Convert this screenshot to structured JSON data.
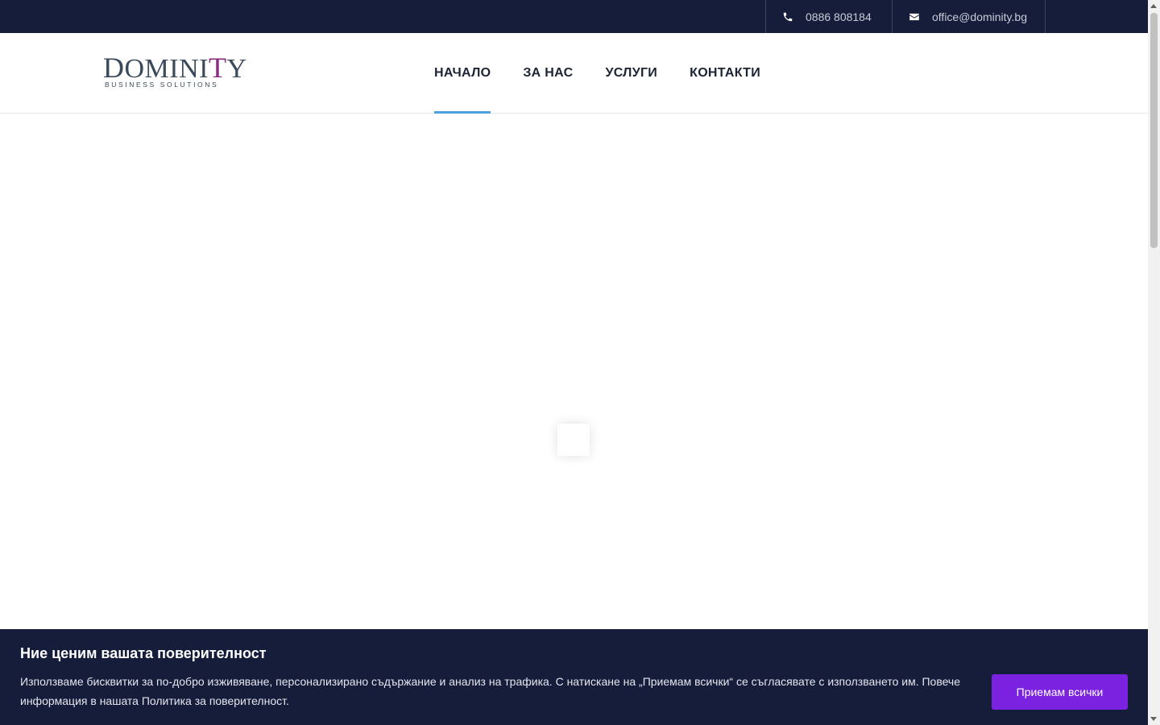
{
  "topbar": {
    "phone": {
      "icon": "phone-icon",
      "text": "0886 808184"
    },
    "email": {
      "icon": "envelope-icon",
      "text": "office@dominity.bg"
    }
  },
  "logo": {
    "word": "DominiTy",
    "tagline": "BUSINESS SOLUTIONS"
  },
  "nav": {
    "items": [
      {
        "label": "НАЧАЛО",
        "active": true
      },
      {
        "label": "ЗА НАС",
        "active": false
      },
      {
        "label": "УСЛУГИ",
        "active": false
      },
      {
        "label": "КОНТАКТИ",
        "active": false
      }
    ]
  },
  "cookie": {
    "title": "Ние ценим вашата поверителност",
    "text": "Използваме бисквитки за по-добро изживяване, персонализирано съдържание и анализ на трафика. С натискане на „Приемам всички“ се съгласявате с използването им. Повече информация в нашата Политика за поверителност.",
    "accept_label": "Приемам всички"
  },
  "colors": {
    "topbar_bg": "#151d3b",
    "nav_active_underline": "#4aa3df",
    "logo_accent": "#8a2a7f",
    "accept_button": "#7b22e0"
  }
}
